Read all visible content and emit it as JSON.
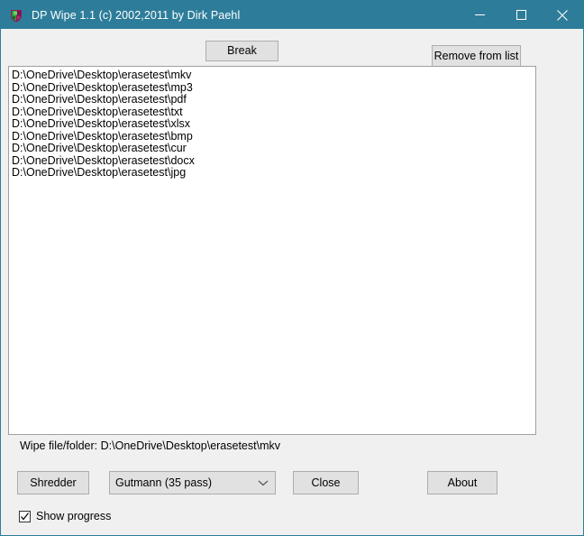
{
  "window": {
    "title": "DP Wipe 1.1 (c) 2002,2011 by Dirk Paehl",
    "icon": "app-shield-icon",
    "titlebar_color": "#2d7d9a",
    "client_color": "#f0f0f0",
    "controls": {
      "minimize": "minimize-icon",
      "maximize": "maximize-icon",
      "close": "close-icon"
    }
  },
  "toolbar": {
    "break_label": "Break",
    "remove_label": "Remove from list"
  },
  "file_list": {
    "items": [
      "D:\\OneDrive\\Desktop\\erasetest\\mkv",
      "D:\\OneDrive\\Desktop\\erasetest\\mp3",
      "D:\\OneDrive\\Desktop\\erasetest\\pdf",
      "D:\\OneDrive\\Desktop\\erasetest\\txt",
      "D:\\OneDrive\\Desktop\\erasetest\\xlsx",
      "D:\\OneDrive\\Desktop\\erasetest\\bmp",
      "D:\\OneDrive\\Desktop\\erasetest\\cur",
      "D:\\OneDrive\\Desktop\\erasetest\\docx",
      "D:\\OneDrive\\Desktop\\erasetest\\jpg"
    ]
  },
  "status": {
    "text": "Wipe file/folder: D:\\OneDrive\\Desktop\\erasetest\\mkv"
  },
  "actions": {
    "shredder_label": "Shredder",
    "close_label": "Close",
    "about_label": "About"
  },
  "method_select": {
    "value": "Gutmann (35 pass)",
    "arrow_icon": "chevron-down-icon"
  },
  "options": {
    "show_progress_label": "Show progress",
    "show_progress_checked": true
  }
}
